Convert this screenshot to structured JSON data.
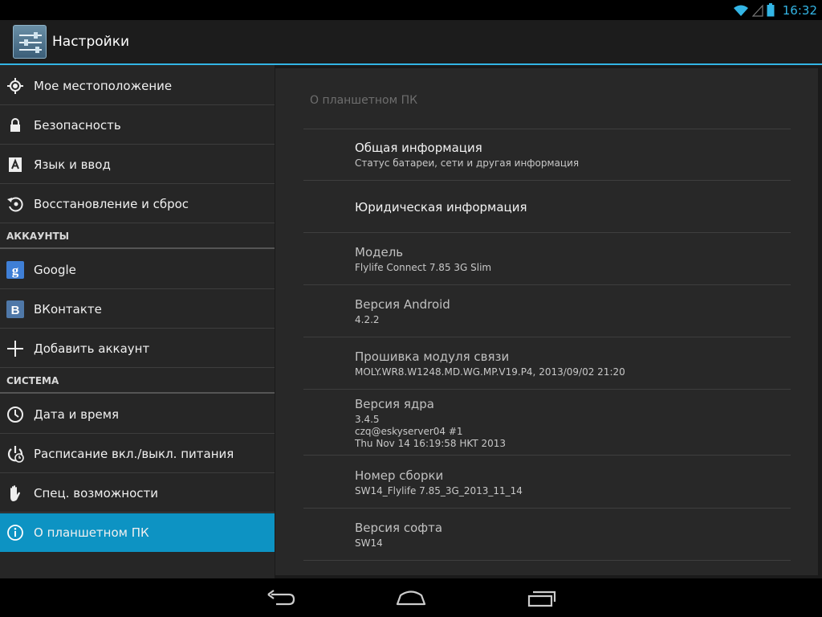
{
  "status_bar": {
    "time": "16:32",
    "icons": [
      "wifi-icon",
      "signal-icon",
      "battery-icon"
    ]
  },
  "action_bar": {
    "title": "Настройки",
    "icon": "settings-sliders-icon"
  },
  "sidebar": {
    "items": [
      {
        "label": "Мое местоположение",
        "icon": "location-icon"
      },
      {
        "label": "Безопасность",
        "icon": "lock-icon"
      },
      {
        "label": "Язык и ввод",
        "icon": "keyboard-a-icon"
      },
      {
        "label": "Восстановление и сброс",
        "icon": "restore-icon"
      },
      {
        "label": "АККАУНТЫ",
        "type": "header"
      },
      {
        "label": "Google",
        "icon": "google-icon"
      },
      {
        "label": "ВКонтакте",
        "icon": "vk-icon"
      },
      {
        "label": "Добавить аккаунт",
        "icon": "plus-icon"
      },
      {
        "label": "СИСТЕМА",
        "type": "header"
      },
      {
        "label": "Дата и время",
        "icon": "clock-icon"
      },
      {
        "label": "Расписание вкл./выкл. питания",
        "icon": "power-schedule-icon"
      },
      {
        "label": "Спец. возможности",
        "icon": "hand-icon"
      },
      {
        "label": "О планшетном ПК",
        "icon": "info-icon",
        "selected": true
      }
    ]
  },
  "detail": {
    "title": "О планшетном ПК",
    "prefs": [
      {
        "title": "Общая информация",
        "summary": "Статус батареи, сети и другая информация"
      },
      {
        "title": "Юридическая информация",
        "summary": ""
      },
      {
        "title": "Модель",
        "summary": "Flylife Connect 7.85 3G Slim"
      },
      {
        "title": "Версия Android",
        "summary": "4.2.2"
      },
      {
        "title": "Прошивка модуля связи",
        "summary": "MOLY.WR8.W1248.MD.WG.MP.V19.P4, 2013/09/02 21:20"
      },
      {
        "title": "Версия ядра",
        "summary": "3.4.5\nczq@eskyserver04 #1\nThu Nov 14 16:19:58 HKT 2013"
      },
      {
        "title": "Номер сборки",
        "summary": "SW14_Flylife 7.85_3G_2013_11_14"
      },
      {
        "title": "Версия софта",
        "summary": "SW14"
      }
    ]
  },
  "nav_bar": {
    "buttons": [
      "back-icon",
      "home-icon",
      "recents-icon"
    ]
  },
  "colors": {
    "accent": "#33b5e5",
    "selected": "#0d93c3"
  }
}
